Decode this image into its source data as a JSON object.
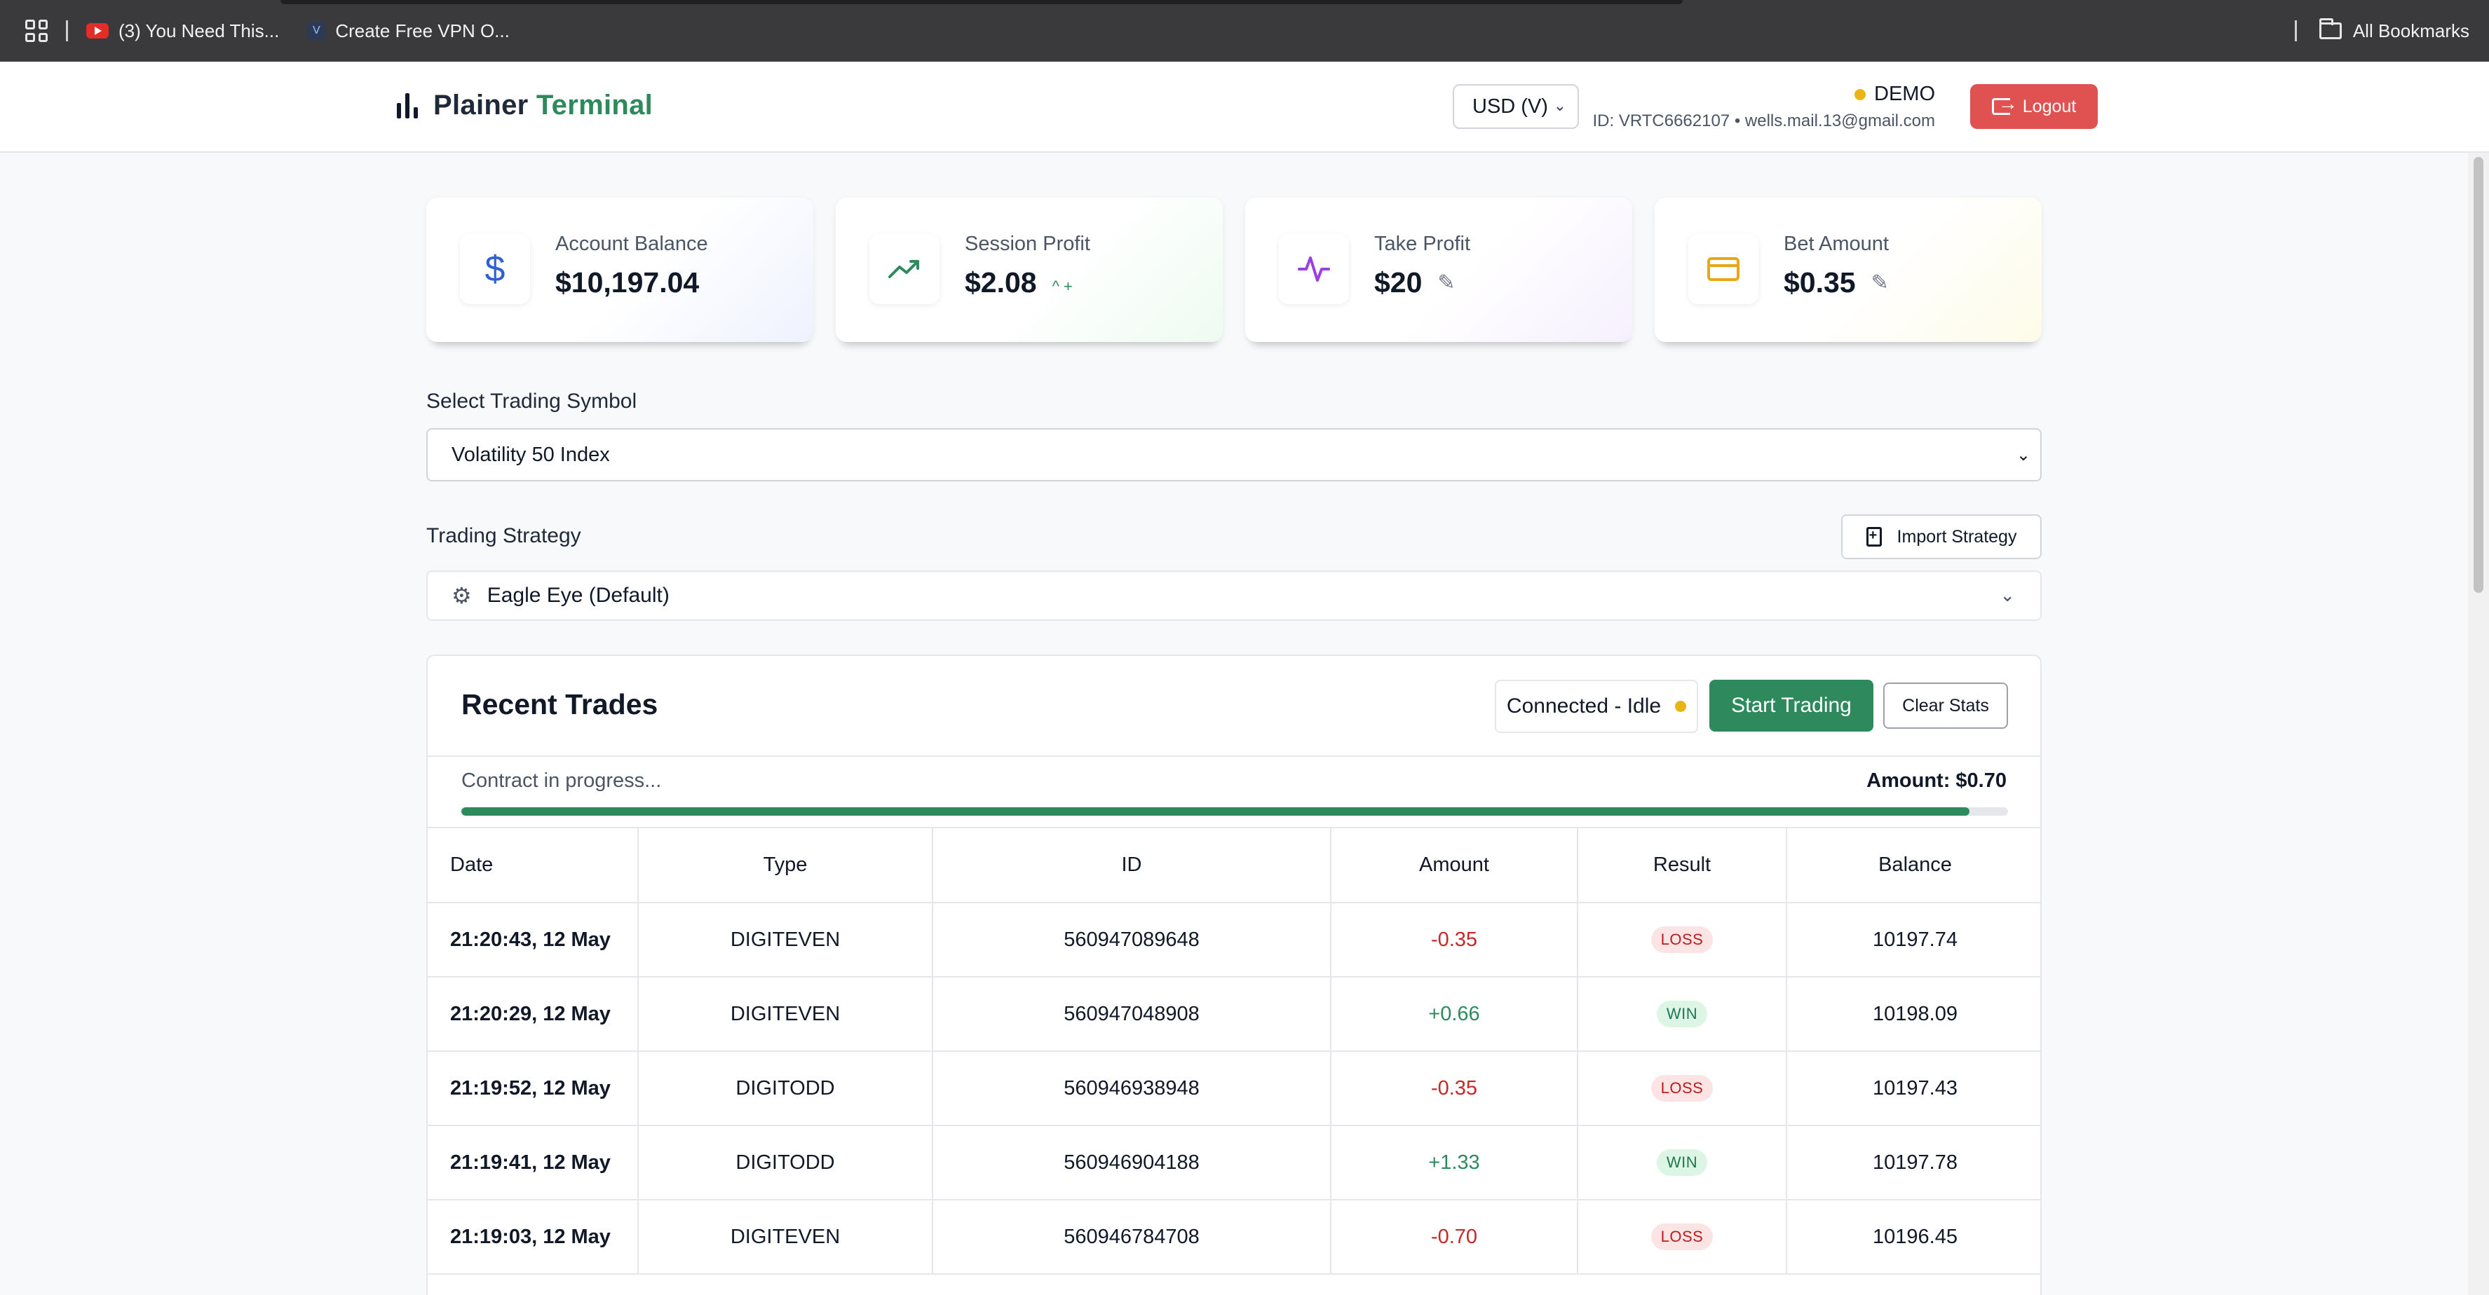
{
  "browser": {
    "bookmarks": [
      {
        "label": "(3) You Need This..."
      },
      {
        "label": "Create Free VPN O..."
      }
    ],
    "all_bookmarks_label": "All Bookmarks"
  },
  "header": {
    "logo_part1": "Plainer",
    "logo_part2": "Terminal",
    "currency": "USD (V)",
    "account_mode": "DEMO",
    "account_id_line": "ID: VRTC6662107 • wells.mail.13@gmail.com",
    "logout_label": "Logout"
  },
  "cards": {
    "balance": {
      "label": "Account Balance",
      "value": "$10,197.04",
      "icon": "dollar-icon"
    },
    "session": {
      "label": "Session Profit",
      "value": "$2.08",
      "trend": "^ +",
      "icon": "trending-up-icon"
    },
    "take_profit": {
      "label": "Take Profit",
      "value": "$20",
      "icon": "activity-icon"
    },
    "bet": {
      "label": "Bet Amount",
      "value": "$0.35",
      "icon": "card-icon"
    }
  },
  "symbol": {
    "label": "Select Trading Symbol",
    "selected": "Volatility 50 Index"
  },
  "strategy": {
    "label": "Trading Strategy",
    "import_label": "Import Strategy",
    "selected": "Eagle Eye (Default)"
  },
  "trades": {
    "title": "Recent Trades",
    "status": "Connected - Idle",
    "start_label": "Start Trading",
    "clear_label": "Clear Stats",
    "progress_label": "Contract in progress...",
    "progress_amount": "Amount: $0.70",
    "progress_fraction": 0.975,
    "columns": [
      "Date",
      "Type",
      "ID",
      "Amount",
      "Result",
      "Balance"
    ],
    "rows": [
      {
        "date": "21:20:43, 12 May",
        "type": "DIGITEVEN",
        "id": "560947089648",
        "amount": "-0.35",
        "result": "LOSS",
        "balance": "10197.74"
      },
      {
        "date": "21:20:29, 12 May",
        "type": "DIGITEVEN",
        "id": "560947048908",
        "amount": "+0.66",
        "result": "WIN",
        "balance": "10198.09"
      },
      {
        "date": "21:19:52, 12 May",
        "type": "DIGITODD",
        "id": "560946938948",
        "amount": "-0.35",
        "result": "LOSS",
        "balance": "10197.43"
      },
      {
        "date": "21:19:41, 12 May",
        "type": "DIGITODD",
        "id": "560946904188",
        "amount": "+1.33",
        "result": "WIN",
        "balance": "10197.78"
      },
      {
        "date": "21:19:03, 12 May",
        "type": "DIGITEVEN",
        "id": "560946784708",
        "amount": "-0.70",
        "result": "LOSS",
        "balance": "10196.45"
      }
    ]
  },
  "colors": {
    "brand_green": "#2e8a5d",
    "logout_red": "#e05252",
    "loss_red": "#c62828",
    "status_yellow": "#e8b512"
  }
}
